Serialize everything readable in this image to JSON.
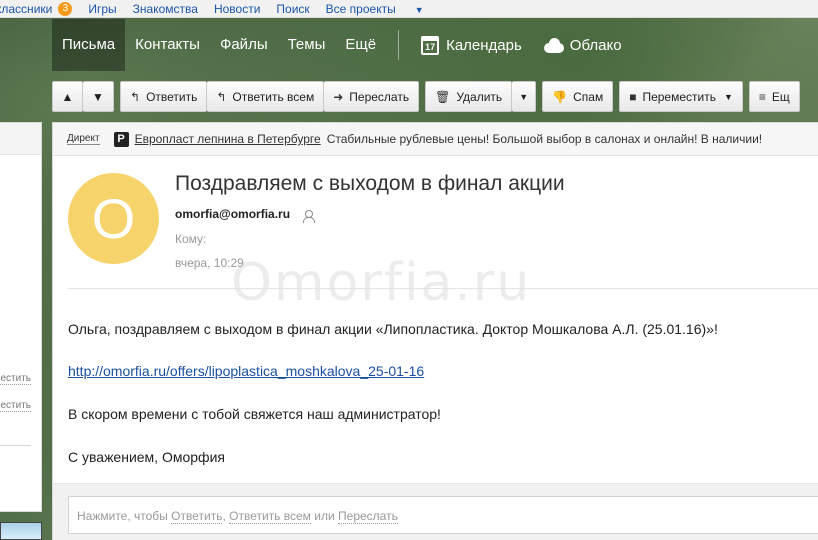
{
  "portal": {
    "items": [
      "классники",
      "Игры",
      "Знакомства",
      "Новости",
      "Поиск",
      "Все проекты"
    ],
    "badge": "3"
  },
  "nav": {
    "items": [
      "Письма",
      "Контакты",
      "Файлы",
      "Темы",
      "Ещё"
    ],
    "calendar_label": "Календарь",
    "calendar_day": "17",
    "cloud_label": "Облако"
  },
  "toolbar": {
    "reply": "Ответить",
    "reply_all": "Ответить всем",
    "forward": "Переслать",
    "delete": "Удалить",
    "spam": "Спам",
    "move": "Переместить",
    "more": "Ещ"
  },
  "ad": {
    "direct": "Директ",
    "icon_letter": "P",
    "link": "Европласт лепнина в Петербурге",
    "text": "Стабильные рублевые цены! Большой выбор в салонах и онлайн! В наличии!"
  },
  "left_panel": {
    "link1": "местить",
    "link2": "местить"
  },
  "message": {
    "avatar_letter": "O",
    "subject": "Поздравляем с выходом в финал акции",
    "sender": "omorfia@omorfia.ru",
    "to_label": "Кому:",
    "date": "вчера, 10:29",
    "watermark": "Omorfia.ru",
    "body": {
      "line1": "Ольга, поздравляем с выходом в финал акции «Липопластика. Доктор Мошкалова А.Л. (25.01.16)»!",
      "link": "http://omorfia.ru/offers/lipoplastica_moshkalova_25-01-16",
      "line3": "В скором времени с тобой свяжется наш администратор!",
      "line4": "С уважением, Оморфия"
    }
  },
  "reply_hint": {
    "prefix": "Нажмите, чтобы",
    "reply": "Ответить",
    "reply_all": "Ответить всем",
    "or": "или",
    "forward": "Переслать"
  }
}
